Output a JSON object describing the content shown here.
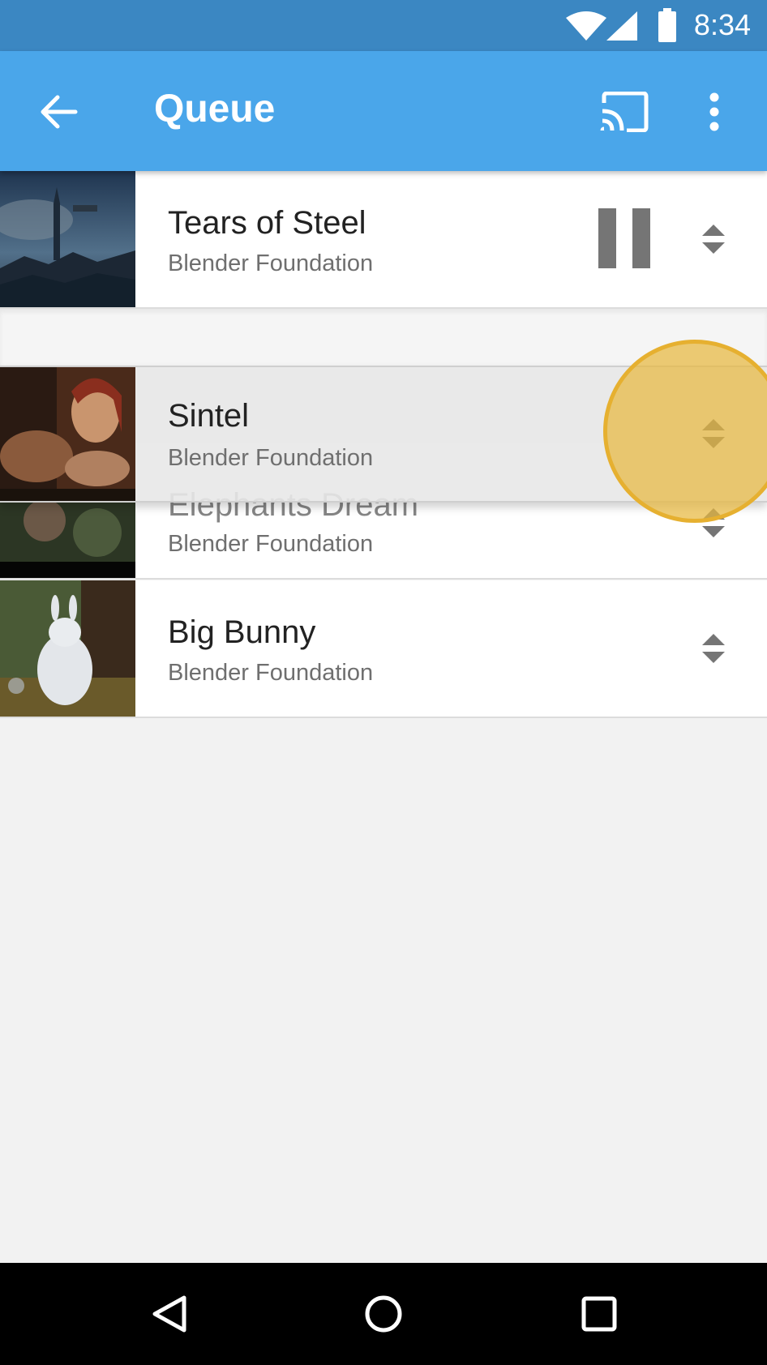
{
  "status_bar": {
    "time": "8:34",
    "icons": [
      "wifi-icon",
      "cell-signal-icon",
      "battery-icon"
    ]
  },
  "app_bar": {
    "title": "Queue",
    "icons": [
      "back-arrow-icon",
      "cast-icon",
      "more-vert-icon"
    ]
  },
  "queue": [
    {
      "title": "Tears of Steel",
      "subtitle": "Blender Foundation",
      "state": "playing"
    },
    {
      "title": "Sintel",
      "subtitle": "Blender Foundation",
      "state": "dragging"
    },
    {
      "title": "Elephants Dream",
      "subtitle": "Blender Foundation",
      "state": "queued"
    },
    {
      "title": "Big Bunny",
      "subtitle": "Blender Foundation",
      "state": "queued"
    }
  ],
  "nav_bar": {
    "icons": [
      "back-triangle-icon",
      "home-circle-icon",
      "recents-square-icon"
    ]
  },
  "colors": {
    "status_bar": "#3b87c2",
    "app_bar": "#4aa6ea",
    "touch_indicator": "#e8b840"
  }
}
